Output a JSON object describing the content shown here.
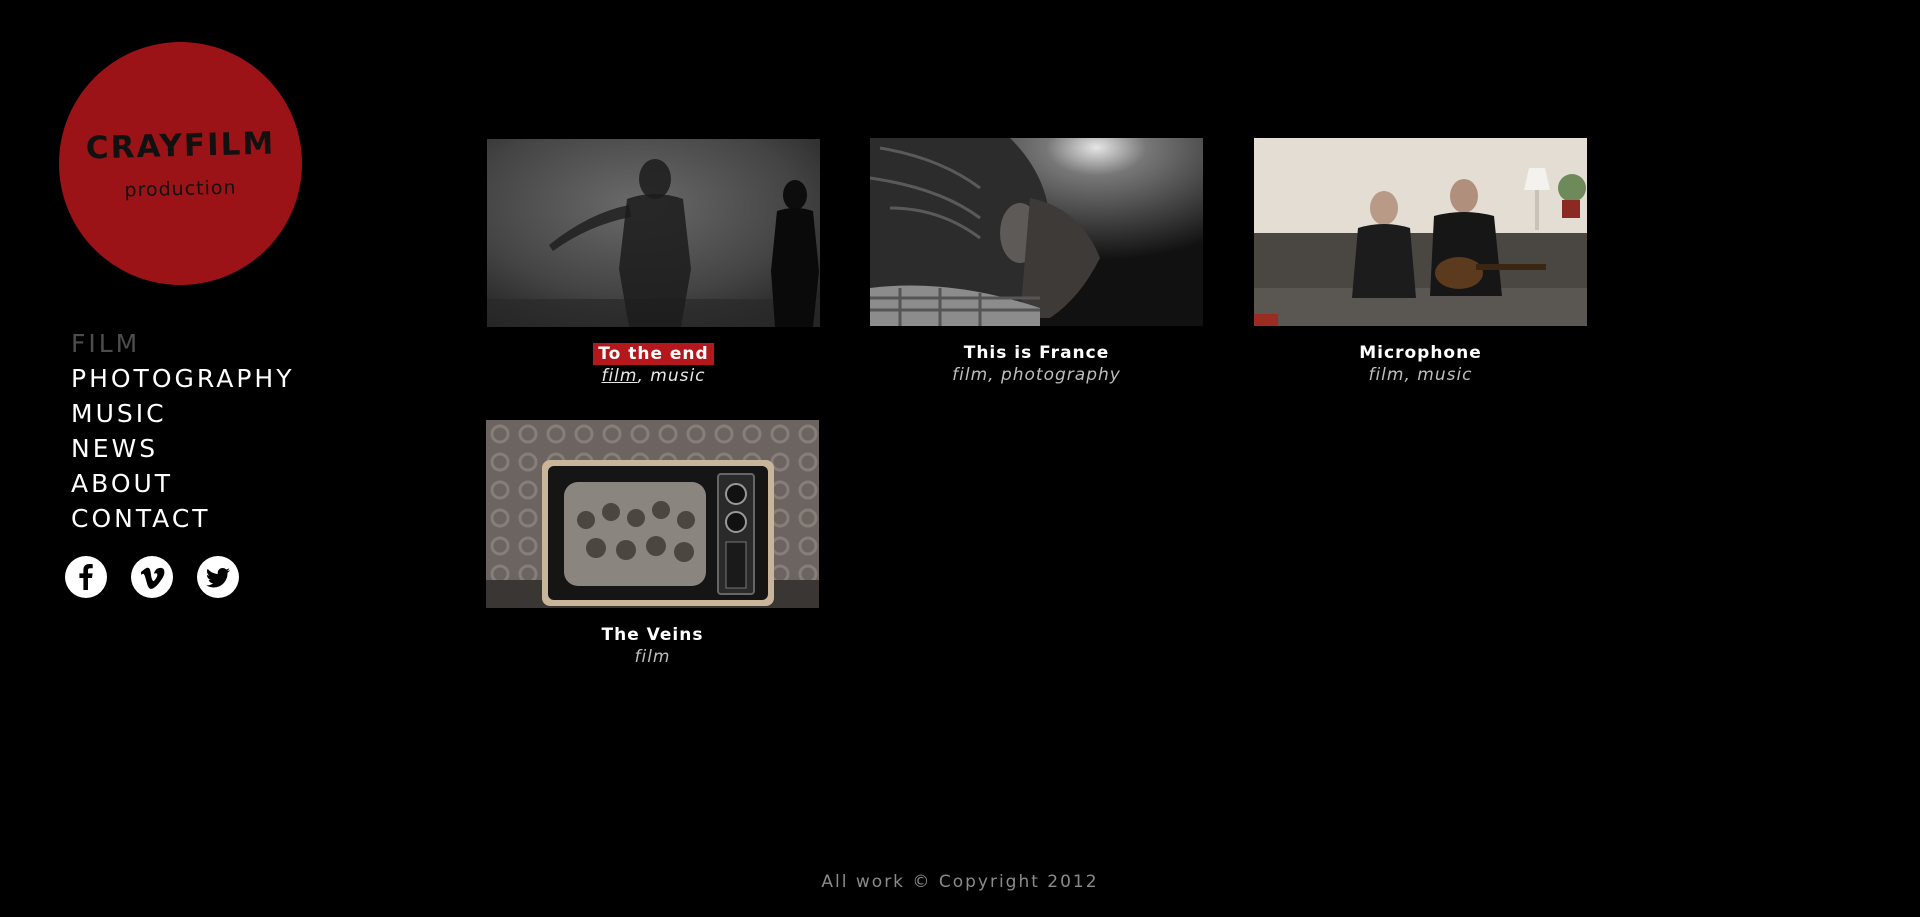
{
  "logo": {
    "name": "CRAYFILM",
    "subtitle": "production",
    "color": "#9b1316"
  },
  "nav": {
    "items": [
      {
        "label": "FILM",
        "active": true
      },
      {
        "label": "PHOTOGRAPHY",
        "active": false
      },
      {
        "label": "MUSIC",
        "active": false
      },
      {
        "label": "NEWS",
        "active": false
      },
      {
        "label": "ABOUT",
        "active": false
      },
      {
        "label": "CONTACT",
        "active": false
      }
    ]
  },
  "social": {
    "icons": [
      "facebook-icon",
      "vimeo-icon",
      "twitter-icon"
    ]
  },
  "gallery": {
    "items": [
      {
        "title": "To the end",
        "tags": [
          "film",
          "music"
        ],
        "highlighted": true
      },
      {
        "title": "This is France",
        "tags": [
          "film",
          "photography"
        ],
        "highlighted": false
      },
      {
        "title": "Microphone",
        "tags": [
          "film",
          "music"
        ],
        "highlighted": false
      },
      {
        "title": "The Veins",
        "tags": [
          "film"
        ],
        "highlighted": false
      }
    ]
  },
  "footer": {
    "text": "All work © Copyright 2012"
  },
  "colors": {
    "background": "#000000",
    "accent": "#b5181c",
    "nav_active": "#4d4d4d",
    "footer_text": "#8a8a8a"
  }
}
